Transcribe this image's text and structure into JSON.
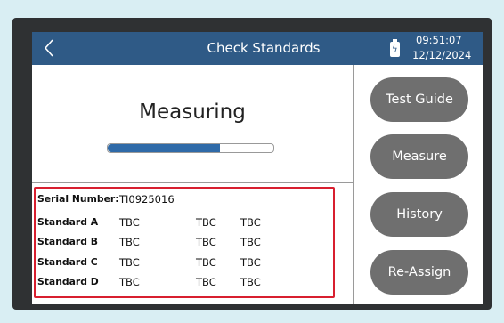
{
  "header": {
    "title": "Check Standards",
    "time": "09:51:07",
    "date": "12/12/2024"
  },
  "status": {
    "label": "Measuring",
    "progress_fraction": 0.68
  },
  "details": {
    "serial_label": "Serial Number:",
    "serial_value": "TI0925016",
    "rows": [
      {
        "label": "Standard A",
        "values": [
          "TBC",
          "TBC",
          "TBC"
        ]
      },
      {
        "label": "Standard B",
        "values": [
          "TBC",
          "TBC",
          "TBC"
        ]
      },
      {
        "label": "Standard C",
        "values": [
          "TBC",
          "TBC",
          "TBC"
        ]
      },
      {
        "label": "Standard D",
        "values": [
          "TBC",
          "TBC",
          "TBC"
        ]
      }
    ]
  },
  "sidebar": {
    "buttons": [
      {
        "label": "Test Guide"
      },
      {
        "label": "Measure"
      },
      {
        "label": "History"
      },
      {
        "label": "Re-Assign"
      }
    ]
  },
  "icons": [
    "back-chevron-icon",
    "battery-charging-icon"
  ],
  "colors": {
    "titlebar": "#2f5a86",
    "progress": "#2f6aa8",
    "highlight": "#d81f2f",
    "button": "#6f6f6f"
  }
}
